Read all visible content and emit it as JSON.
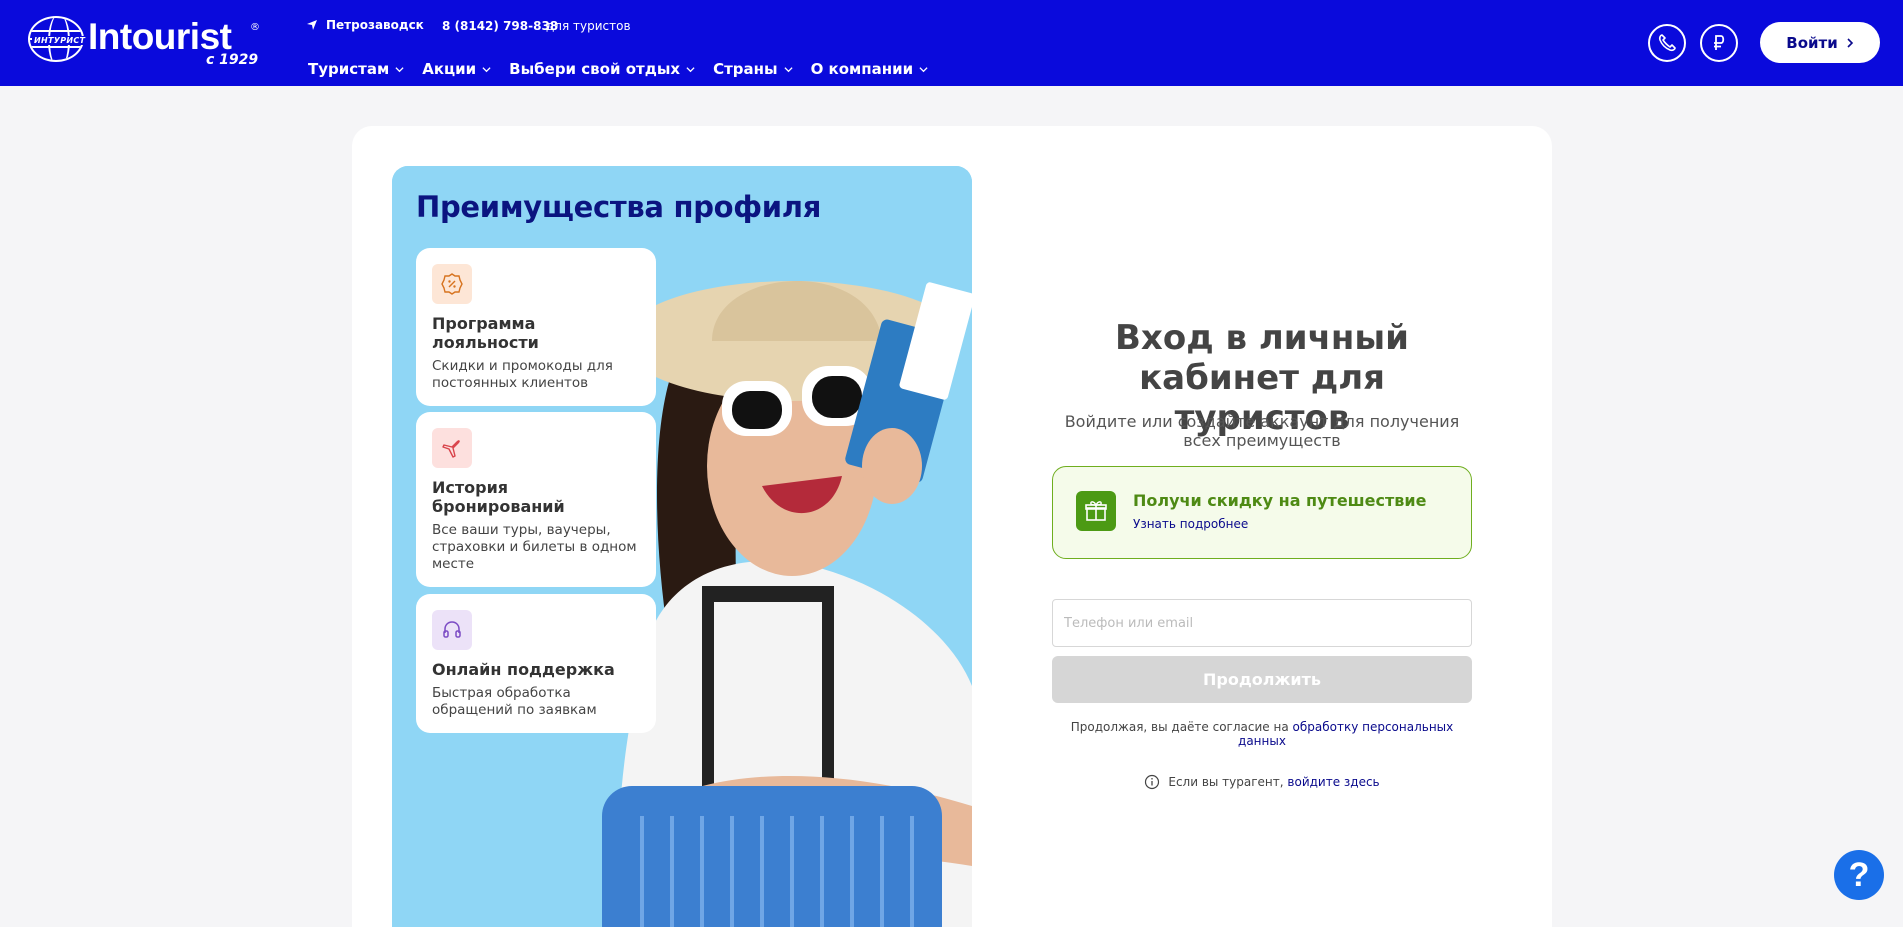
{
  "header": {
    "logo_text": "Intourist",
    "logo_small": "ИНТУРИСТ",
    "logo_since": "с 1929",
    "location": "Петрозаводск",
    "phone": "8 (8142) 798-838",
    "phone_note": "для туристов",
    "nav": [
      {
        "label": "Туристам"
      },
      {
        "label": "Акции"
      },
      {
        "label": "Выбери свой отдых"
      },
      {
        "label": "Страны"
      },
      {
        "label": "О компании"
      }
    ],
    "login_label": "Войти",
    "brand_color": "#0a0adc"
  },
  "promo": {
    "title": "Преимущества профиля",
    "benefits": [
      {
        "icon": "percent-badge-icon",
        "title": "Программа лояльности",
        "desc": "Скидки и промокоды для постоянных клиентов"
      },
      {
        "icon": "airplane-icon",
        "title": "История бронирований",
        "desc": "Все ваши туры, ваучеры, страховки и билеты в одном месте"
      },
      {
        "icon": "headset-icon",
        "title": "Онлайн поддержка",
        "desc": "Быстрая обработка обращений по заявкам"
      }
    ]
  },
  "form": {
    "title": "Вход в личный кабинет для туристов",
    "subtitle": "Войдите или создайте аккаунт для получения всех преимуществ",
    "discount_title": "Получи скидку на путешествие",
    "discount_link": "Узнать подробнее",
    "input_placeholder": "Телефон или email",
    "continue_label": "Продолжить",
    "consent_text": "Продолжая, вы даёте согласие на ",
    "consent_link": "обработку персональных данных",
    "agent_text": "Если вы турагент, ",
    "agent_link": "войдите здесь"
  },
  "help": {
    "label": "?"
  }
}
